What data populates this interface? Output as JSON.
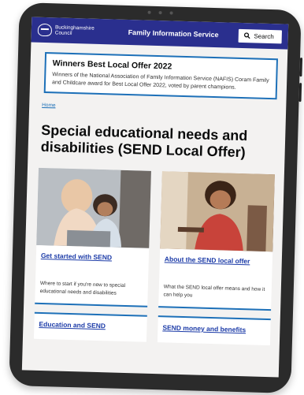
{
  "header": {
    "council_line1": "Buckinghamshire",
    "council_line2": "Council",
    "service_name": "Family Information Service",
    "search_label": "Search"
  },
  "notice": {
    "title": "Winners Best Local Offer 2022",
    "body": "Winners of the National Association of Family Information Service (NAFIS) Coram Family and Childcare award for Best Local Offer 2022, voted by parent champions."
  },
  "breadcrumb": {
    "home": "Home"
  },
  "page_title": "Special educational needs and disabilities (SEND Local Offer)",
  "cards": [
    {
      "title": "Get started with SEND",
      "description": "Where to start if you're new to special educational needs and disabilities"
    },
    {
      "title": "About the SEND local offer",
      "description": "What the SEND local offer means and how it can help you"
    },
    {
      "title": "Education and SEND"
    },
    {
      "title": "SEND money and benefits"
    }
  ],
  "icons": {
    "search": "search-icon",
    "logo": "council-logo-icon"
  }
}
